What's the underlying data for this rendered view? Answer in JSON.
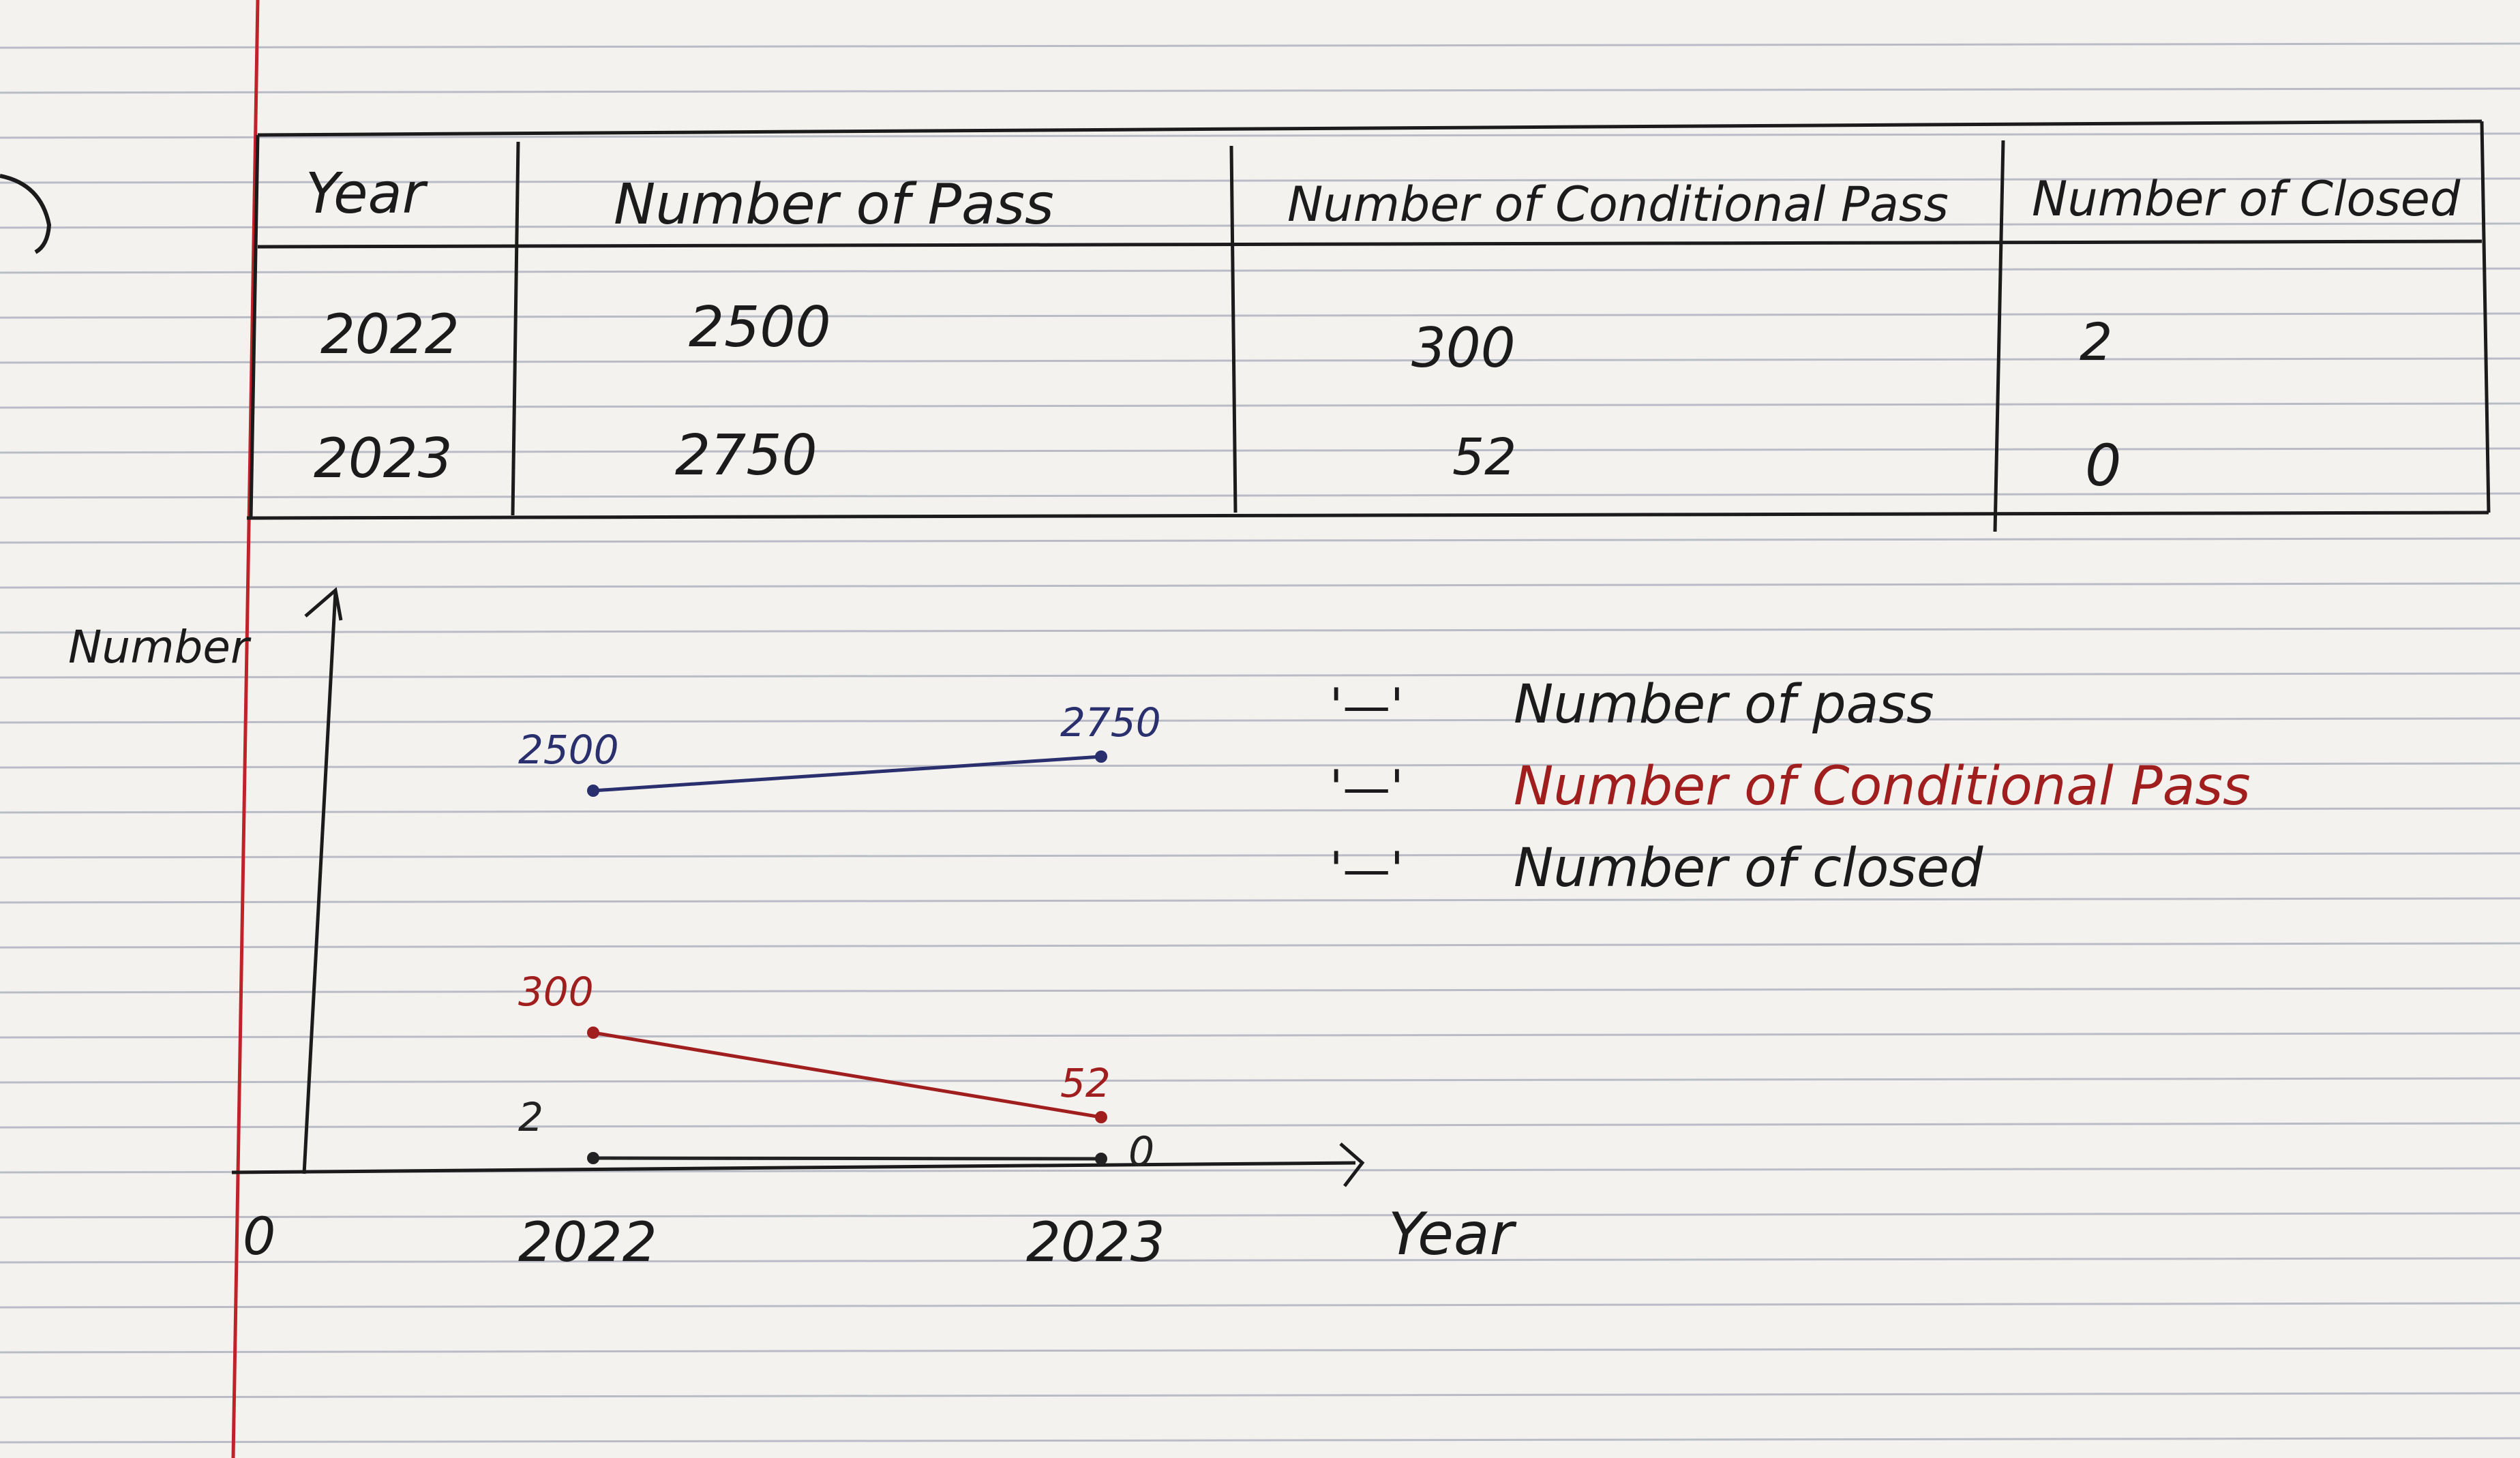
{
  "table": {
    "headers": [
      "Year",
      "Number of Pass",
      "Number of Conditional Pass",
      "Number of Closed"
    ],
    "rows": [
      [
        "2022",
        "2500",
        "300",
        "2"
      ],
      [
        "2023",
        "2750",
        "52",
        "0"
      ]
    ]
  },
  "chart_data": {
    "type": "line",
    "xlabel": "Year",
    "ylabel": "Number",
    "origin_label": "0",
    "categories": [
      "2022",
      "2023"
    ],
    "series": [
      {
        "name": "Number of pass",
        "values": [
          2500,
          2750
        ],
        "color": "#2a2f6e"
      },
      {
        "name": "Number of Conditional Pass",
        "values": [
          300,
          52
        ],
        "color": "#a01e1e"
      },
      {
        "name": "Number of closed",
        "values": [
          2,
          0
        ],
        "color": "#222222"
      }
    ],
    "point_labels": [
      [
        "2500",
        "2750"
      ],
      [
        "300",
        "52"
      ],
      [
        "2",
        "0"
      ]
    ],
    "legend_marker": "'—'",
    "legend_position": "right"
  },
  "colors": {
    "paper": "#f3f2ee",
    "rule_line": "#b9bcc6",
    "margin_line": "#c0222a",
    "ink": "#1b1b1b"
  }
}
